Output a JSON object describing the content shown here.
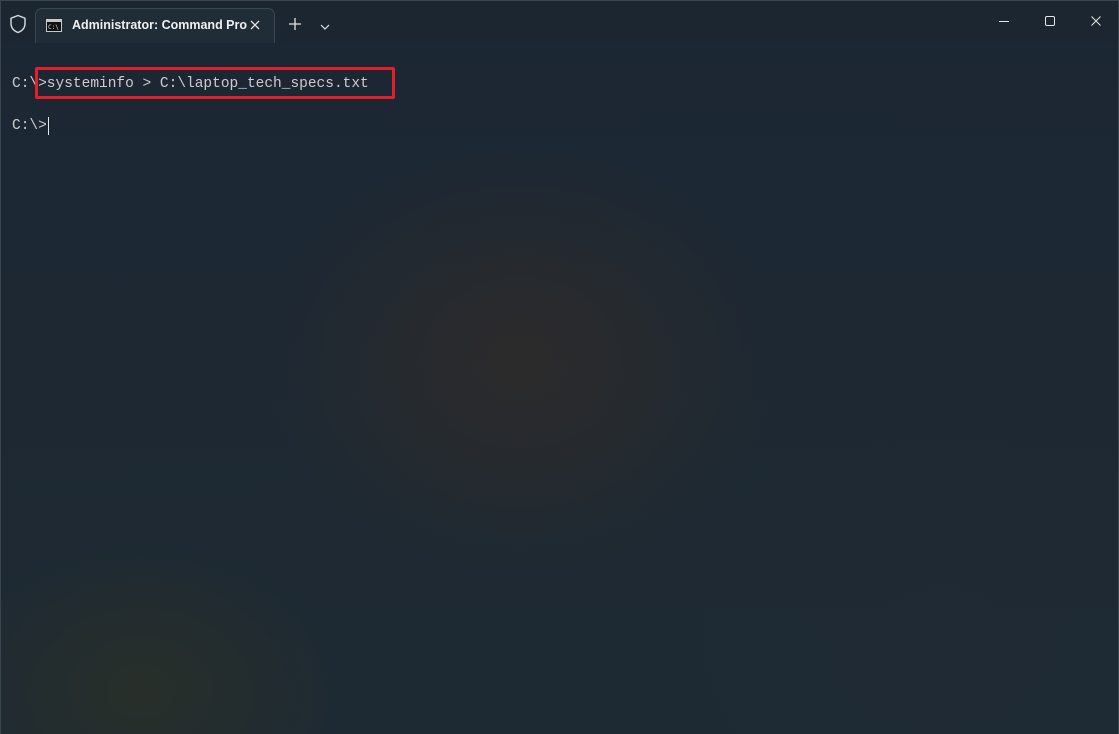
{
  "window": {
    "tab_title": "Administrator: Command Pro",
    "tab_icon": "cmd-icon",
    "shield_icon": "shield-icon",
    "new_tab_icon": "plus-icon",
    "dropdown_icon": "chevron-down-icon",
    "controls": [
      "minimize-icon",
      "maximize-icon",
      "close-icon"
    ]
  },
  "terminal": {
    "line1_prompt": "C:\\",
    "line1_command": ">systeminfo > C:\\laptop_tech_specs.txt",
    "line2_prompt": "C:\\>",
    "highlight_color": "#e0202a",
    "text_color": "#cccccc"
  }
}
